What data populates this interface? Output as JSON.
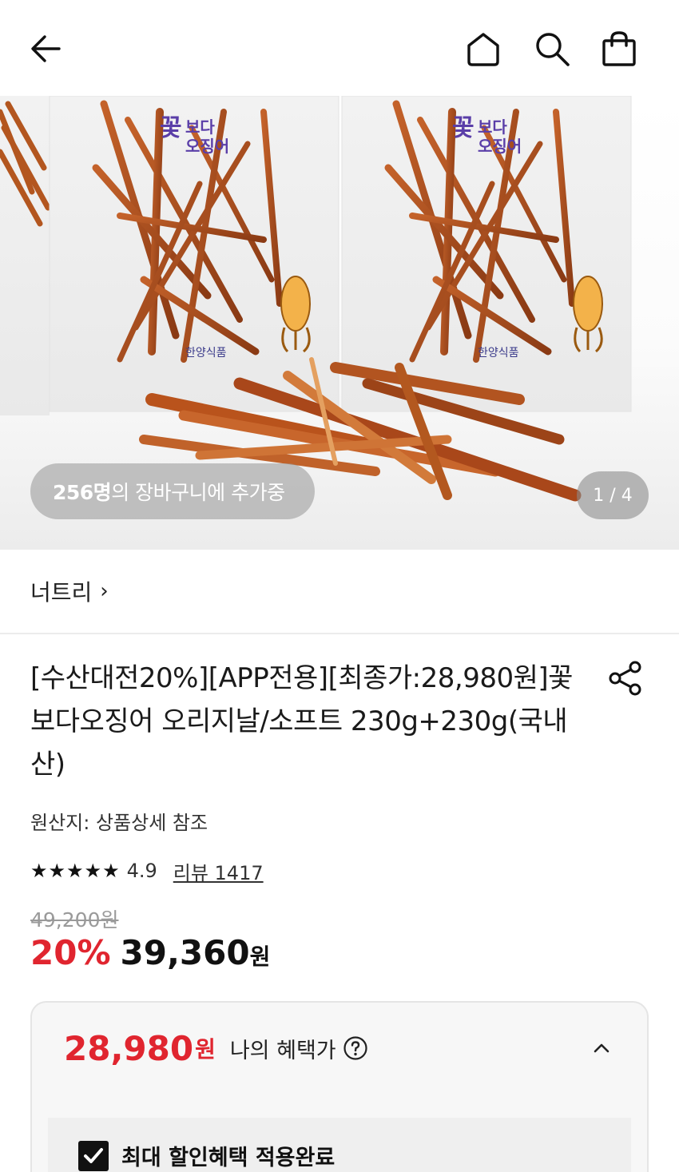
{
  "header": {
    "back_icon": "arrow-left-icon",
    "home_icon": "home-icon",
    "search_icon": "search-icon",
    "cart_icon": "shopping-bag-icon"
  },
  "hero": {
    "cart_count_number": "256명",
    "cart_count_text": "의 장바구니에 추가중",
    "pager": "1 / 4",
    "package_brand": "꽃보다오징어",
    "package_maker": "한양식품"
  },
  "brand": {
    "name": "너트리",
    "chevron": "›"
  },
  "product": {
    "title": "[수산대전20%][APP전용][최종가:28,980원]꽃보다오징어 오리지날/소프트 230g+230g(국내산)",
    "share_icon": "share-icon",
    "origin": "원산지: 상품상세 참조",
    "stars": "★★★★★",
    "rating": "4.9",
    "reviews": "리뷰 1417",
    "original_price": "49,200원",
    "discount": "20%",
    "sale_price": "39,360",
    "sale_currency": "원"
  },
  "benefit": {
    "price": "28,980",
    "currency": "원",
    "label": "나의 혜택가",
    "help_icon": "question-circle-icon",
    "collapse_icon": "chevron-up-icon",
    "checked_label": "최대 할인혜택 적용완료",
    "checked": true
  },
  "colors": {
    "accent_red": "#e0252f",
    "text_dark": "#111111",
    "strike_gray": "#9a9a9a"
  }
}
